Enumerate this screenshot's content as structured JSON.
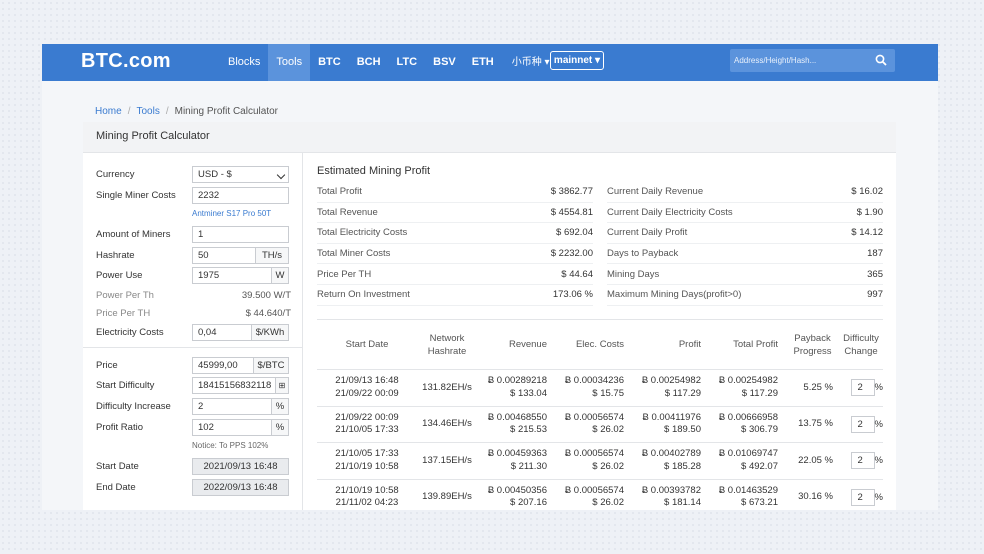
{
  "nav": {
    "logo": "BTC.com",
    "links": [
      "Blocks",
      "Tools"
    ],
    "coins": [
      "BTC",
      "BCH",
      "LTC",
      "BSV",
      "ETH"
    ],
    "small_coins": "小币种",
    "network": "mainnet",
    "search_placeholder": "Address/Height/Hash..."
  },
  "breadcrumb": {
    "home": "Home",
    "tools": "Tools",
    "current": "Mining Profit Calculator"
  },
  "panel_title": "Mining Profit Calculator",
  "form": {
    "currency_label": "Currency",
    "currency_value": "USD - $",
    "miner_cost_label": "Single Miner Costs",
    "miner_cost_value": "2232",
    "miner_model_link": "Antminer S17 Pro 50T",
    "amount_label": "Amount of Miners",
    "amount_value": "1",
    "hashrate_label": "Hashrate",
    "hashrate_value": "50",
    "hashrate_unit": "TH/s",
    "power_label": "Power Use",
    "power_value": "1975",
    "power_unit": "W",
    "power_per_th_label": "Power Per Th",
    "power_per_th_value": "39.500 W/T",
    "price_per_th_label": "Price Per TH",
    "price_per_th_value": "$ 44.640/T",
    "elec_label": "Electricity Costs",
    "elec_value": "0,04",
    "elec_unit": "$/KWh",
    "price_label": "Price",
    "price_value": "45999,00",
    "price_unit": "$/BTC",
    "difficulty_label": "Start Difficulty",
    "difficulty_value": "18415156832118",
    "diff_inc_label": "Difficulty Increase",
    "diff_inc_value": "2",
    "diff_inc_unit": "%",
    "profit_ratio_label": "Profit Ratio",
    "profit_ratio_value": "102",
    "profit_ratio_unit": "%",
    "notice": "Notice: To PPS 102%",
    "start_date_label": "Start Date",
    "start_date_value": "2021/09/13 16:48",
    "end_date_label": "End Date",
    "end_date_value": "2022/09/13 16:48"
  },
  "summary": {
    "title": "Estimated Mining Profit",
    "left": [
      {
        "k": "Total Profit",
        "v": "$ 3862.77"
      },
      {
        "k": "Total Revenue",
        "v": "$ 4554.81"
      },
      {
        "k": "Total Electricity Costs",
        "v": "$ 692.04"
      },
      {
        "k": "Total Miner Costs",
        "v": "$ 2232.00"
      },
      {
        "k": "Price Per TH",
        "v": "$ 44.64"
      },
      {
        "k": "Return On Investment",
        "v": "173.06 %"
      }
    ],
    "right": [
      {
        "k": "Current Daily Revenue",
        "v": "$ 16.02"
      },
      {
        "k": "Current Daily Electricity Costs",
        "v": "$ 1.90"
      },
      {
        "k": "Current Daily Profit",
        "v": "$ 14.12"
      },
      {
        "k": "Days to Payback",
        "v": "187"
      },
      {
        "k": "Mining Days",
        "v": "365"
      },
      {
        "k": "Maximum Mining Days(profit>0)",
        "v": "997"
      }
    ]
  },
  "table": {
    "headers": {
      "start": "Start Date",
      "network1": "Network",
      "network2": "Hashrate",
      "revenue": "Revenue",
      "elec": "Elec. Costs",
      "profit": "Profit",
      "total": "Total Profit",
      "payback1": "Payback",
      "payback2": "Progress",
      "diff1": "Difficulty",
      "diff2": "Change"
    },
    "rows": [
      {
        "d1": "21/09/13 16:48",
        "d2": "21/09/22 00:09",
        "hash": "131.82EH/s",
        "rev1": "Ƀ 0.00289218",
        "rev2": "$ 133.04",
        "el1": "Ƀ 0.00034236",
        "el2": "$ 15.75",
        "pr1": "Ƀ 0.00254982",
        "pr2": "$ 117.29",
        "tp1": "Ƀ 0.00254982",
        "tp2": "$ 117.29",
        "payback": "5.25 %",
        "diff": "2",
        "unit": "%"
      },
      {
        "d1": "21/09/22 00:09",
        "d2": "21/10/05 17:33",
        "hash": "134.46EH/s",
        "rev1": "Ƀ 0.00468550",
        "rev2": "$ 215.53",
        "el1": "Ƀ 0.00056574",
        "el2": "$ 26.02",
        "pr1": "Ƀ 0.00411976",
        "pr2": "$ 189.50",
        "tp1": "Ƀ 0.00666958",
        "tp2": "$ 306.79",
        "payback": "13.75 %",
        "diff": "2",
        "unit": "%"
      },
      {
        "d1": "21/10/05 17:33",
        "d2": "21/10/19 10:58",
        "hash": "137.15EH/s",
        "rev1": "Ƀ 0.00459363",
        "rev2": "$ 211.30",
        "el1": "Ƀ 0.00056574",
        "el2": "$ 26.02",
        "pr1": "Ƀ 0.00402789",
        "pr2": "$ 185.28",
        "tp1": "Ƀ 0.01069747",
        "tp2": "$ 492.07",
        "payback": "22.05 %",
        "diff": "2",
        "unit": "%"
      },
      {
        "d1": "21/10/19 10:58",
        "d2": "21/11/02 04:23",
        "hash": "139.89EH/s",
        "rev1": "Ƀ 0.00450356",
        "rev2": "$ 207.16",
        "el1": "Ƀ 0.00056574",
        "el2": "$ 26.02",
        "pr1": "Ƀ 0.00393782",
        "pr2": "$ 181.14",
        "tp1": "Ƀ 0.01463529",
        "tp2": "$ 673.21",
        "payback": "30.16 %",
        "diff": "2",
        "unit": "%"
      }
    ]
  }
}
